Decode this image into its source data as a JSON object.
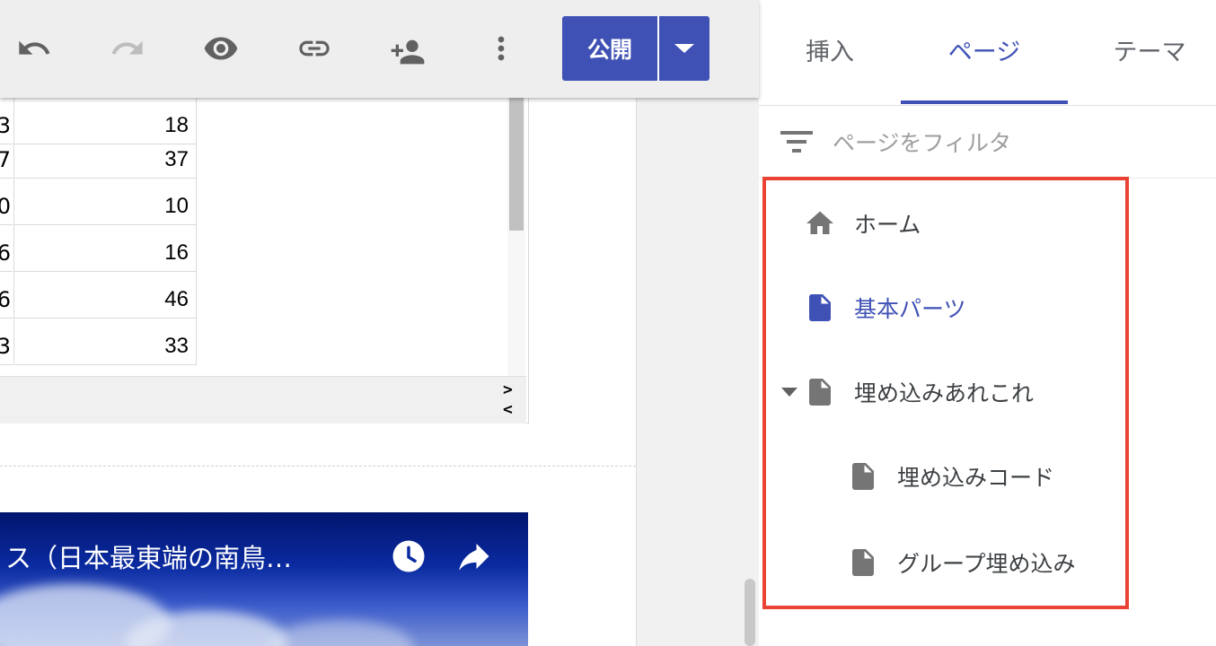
{
  "toolbar": {
    "icons": [
      "undo-icon",
      "redo-icon",
      "preview-icon",
      "link-icon",
      "share-icon",
      "more-vert-icon"
    ],
    "publish_label": "公開",
    "colors": {
      "accent": "#3f51b5",
      "toolbar_bg": "#eeeeee"
    }
  },
  "sheet": {
    "rows": [
      {
        "a": "3",
        "b": "18"
      },
      {
        "a": "7",
        "b": "37"
      },
      {
        "a": "0",
        "b": "10"
      },
      {
        "a": "6",
        "b": "16"
      },
      {
        "a": "6",
        "b": "46"
      },
      {
        "a": "3",
        "b": "33"
      }
    ],
    "scroll_right": ">",
    "scroll_left": "<"
  },
  "video": {
    "title": "ス（日本最東端の南鳥…",
    "icons": [
      "watch-later-icon",
      "share-arrow-icon"
    ]
  },
  "panel": {
    "tabs": [
      {
        "label": "挿入",
        "active": false
      },
      {
        "label": "ページ",
        "active": true
      },
      {
        "label": "テーマ",
        "active": false
      }
    ],
    "filter": {
      "placeholder": "ページをフィルタ",
      "value": ""
    },
    "pages": [
      {
        "label": "ホーム",
        "icon": "home-icon",
        "selected": false
      },
      {
        "label": "基本パーツ",
        "icon": "page-icon",
        "selected": true
      },
      {
        "label": "埋め込みあれこれ",
        "icon": "page-icon",
        "selected": false,
        "expanded": true
      },
      {
        "label": "埋め込みコード",
        "icon": "page-icon",
        "selected": false
      },
      {
        "label": "グループ埋め込み",
        "icon": "page-icon",
        "selected": false
      }
    ],
    "colors": {
      "highlight_border": "#ea4335",
      "selected_text": "#3f51b5",
      "icon_gray": "#757575"
    }
  }
}
